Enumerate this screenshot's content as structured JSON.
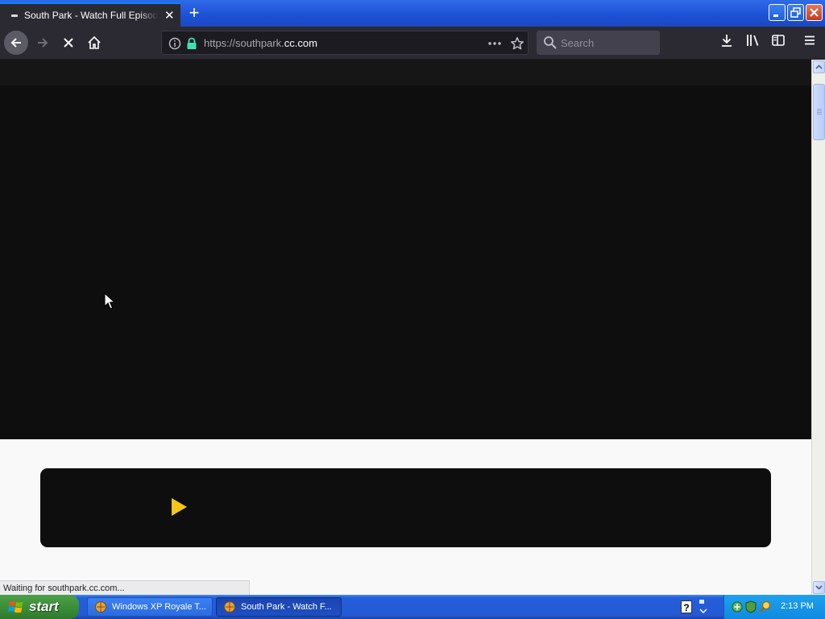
{
  "browser": {
    "tab": {
      "title": "South Park - Watch Full Episodes F"
    },
    "url": {
      "prefix": "https://southpark.",
      "domain": "cc.com"
    },
    "search": {
      "placeholder": "Search"
    }
  },
  "page": {
    "status_text": "Waiting for southpark.cc.com...",
    "player_accent": "#f5c518"
  },
  "taskbar": {
    "start_label": "start",
    "tasks": [
      {
        "label": "Windows XP Royale T..."
      },
      {
        "label": "South Park - Watch F..."
      }
    ],
    "clock": "2:13 PM"
  },
  "colors": {
    "toolbar_bg": "#2b2a33",
    "video_bg": "#0e0e0e",
    "xp_blue": "#245edb",
    "start_green": "#3c8f39"
  }
}
